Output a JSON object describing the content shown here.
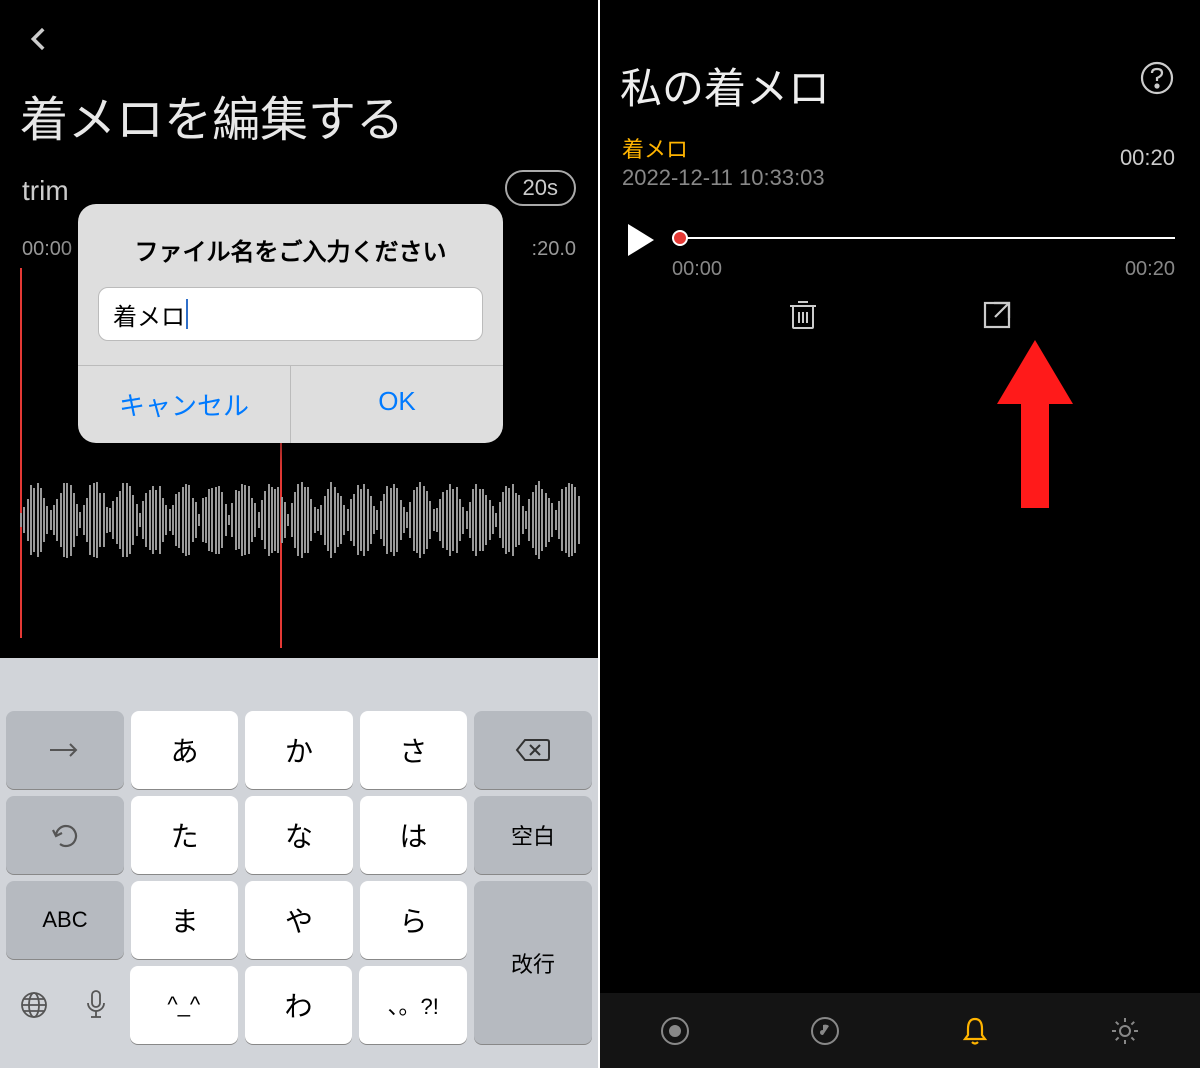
{
  "left": {
    "title": "着メロを編集する",
    "trim_label": "trim",
    "duration_badge": "20s",
    "time_start": "00:00",
    "time_end": ":20.0",
    "dialog": {
      "title": "ファイル名をご入力ください",
      "input_value": "着メロ",
      "cancel": "キャンセル",
      "ok": "OK"
    },
    "keyboard": {
      "rows": [
        [
          "→",
          "あ",
          "か",
          "さ",
          "⌫"
        ],
        [
          "↺",
          "た",
          "な",
          "は",
          "空白"
        ],
        [
          "ABC",
          "ま",
          "や",
          "ら",
          "改行"
        ],
        [
          "🌐",
          "🎤",
          "^_^",
          "わ",
          "、。?!",
          ""
        ]
      ]
    }
  },
  "right": {
    "title": "私の着メロ",
    "item_name": "着メロ",
    "item_date": "2022-12-11 10:33:03",
    "item_duration": "00:20",
    "progress_start": "00:00",
    "progress_end": "00:20"
  }
}
